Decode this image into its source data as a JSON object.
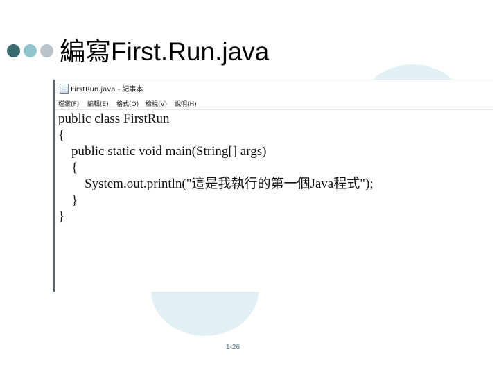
{
  "slide": {
    "title": "編寫First.Run.java",
    "page_number": "1-26"
  },
  "window": {
    "title": "FirstRun.java - 記事本",
    "menu": [
      "檔案(F)",
      "編輯(E)",
      "格式(O)",
      "檢視(V)",
      "說明(H)"
    ]
  },
  "code_lines": [
    "public class FirstRun",
    "{",
    "    public static void main(String[] args)",
    "    {",
    "        System.out.println(\"這是我執行的第一個Java程式\");",
    "    }",
    "}"
  ],
  "colors": {
    "dot_dark": "#3a6b6f",
    "dot_teal": "#8fc4cc",
    "dot_gray": "#b9c3c8",
    "deco_circle": "#e3f0f3",
    "page_number": "#4b6f8c"
  }
}
